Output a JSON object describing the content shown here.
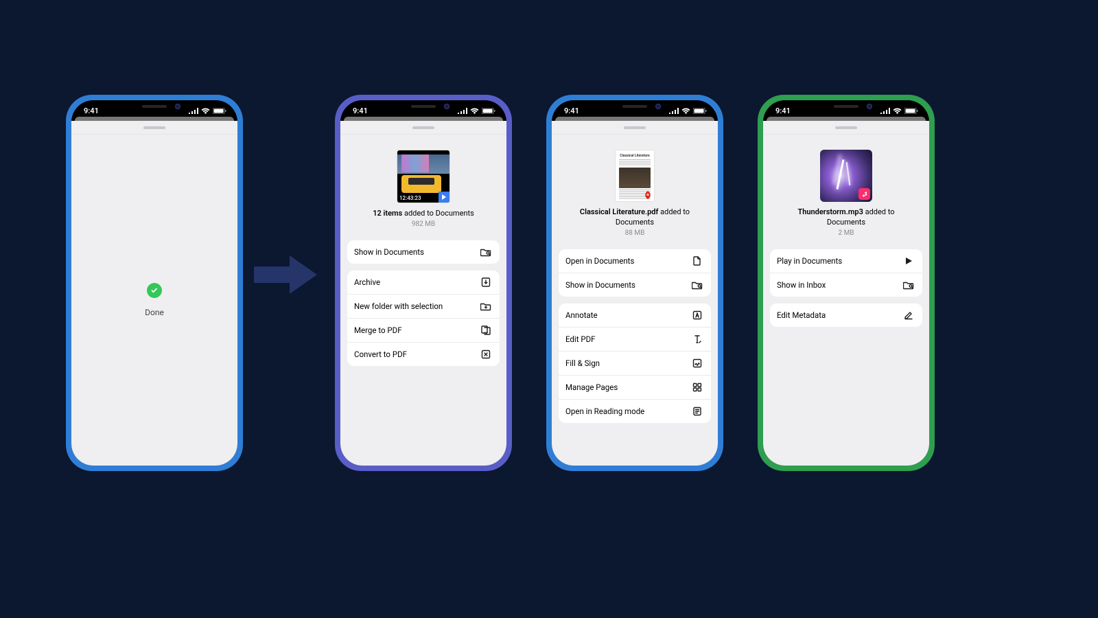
{
  "status": {
    "time": "9:41"
  },
  "phone1": {
    "done_label": "Done"
  },
  "phone2": {
    "thumb_timestamp": "12:43:23",
    "header_bold": "12 items",
    "header_rest": " added to Documents",
    "sub": "982 MB",
    "group1": [
      {
        "label": "Show in Documents",
        "icon": "folder-search-icon"
      }
    ],
    "group2": [
      {
        "label": "Archive",
        "icon": "archive-icon"
      },
      {
        "label": "New folder with selection",
        "icon": "new-folder-icon"
      },
      {
        "label": "Merge to PDF",
        "icon": "merge-pdf-icon"
      },
      {
        "label": "Convert to PDF",
        "icon": "convert-pdf-icon"
      }
    ]
  },
  "phone3": {
    "thumb_title": "Classical Literature",
    "header_bold": "Classical Literature.pdf",
    "header_rest": " added to Documents",
    "sub": "88 MB",
    "group1": [
      {
        "label": "Open in Documents",
        "icon": "document-icon"
      },
      {
        "label": "Show in Documents",
        "icon": "folder-search-icon"
      }
    ],
    "group2": [
      {
        "label": "Annotate",
        "icon": "annotate-icon"
      },
      {
        "label": "Edit PDF",
        "icon": "text-cursor-icon"
      },
      {
        "label": "Fill & Sign",
        "icon": "sign-icon"
      },
      {
        "label": "Manage Pages",
        "icon": "grid-icon"
      },
      {
        "label": "Open in Reading mode",
        "icon": "reading-icon"
      }
    ]
  },
  "phone4": {
    "header_bold": "Thunderstorm.mp3",
    "header_rest": " added to Documents",
    "sub": "2 MB",
    "group1": [
      {
        "label": "Play in Documents",
        "icon": "play-icon"
      },
      {
        "label": "Show in Inbox",
        "icon": "folder-search-icon"
      }
    ],
    "group2": [
      {
        "label": "Edit Metadata",
        "icon": "edit-icon"
      }
    ]
  }
}
